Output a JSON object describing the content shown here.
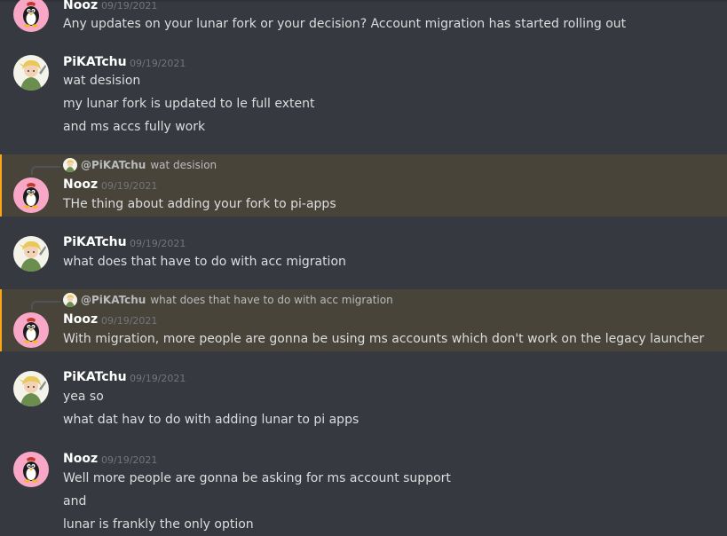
{
  "users": {
    "nooz": {
      "name": "Nooz",
      "avatar_icon": "tux-penguin-avatar",
      "avatar_color": "#f9a7c6"
    },
    "pika": {
      "name": "PiKATchu",
      "avatar_icon": "anime-character-avatar",
      "avatar_color": "#f3f3ea"
    }
  },
  "messages": [
    {
      "author": "Nooz",
      "timestamp": "09/19/2021",
      "lines": [
        "Any updates on your lunar fork or your decision? Account migration has started rolling out"
      ]
    },
    {
      "author": "PiKATchu",
      "timestamp": "09/19/2021",
      "lines": [
        "wat desision",
        "my lunar fork is updated to le full extent",
        "and ms accs fully work"
      ]
    },
    {
      "author": "Nooz",
      "timestamp": "09/19/2021",
      "highlighted": true,
      "reply_to": {
        "name": "@PiKATchu",
        "text": "wat desision"
      },
      "lines": [
        "THe thing about adding your fork to pi-apps"
      ]
    },
    {
      "author": "PiKATchu",
      "timestamp": "09/19/2021",
      "lines": [
        "what does that have to do with acc migration"
      ]
    },
    {
      "author": "Nooz",
      "timestamp": "09/19/2021",
      "highlighted": true,
      "reply_to": {
        "name": "@PiKATchu",
        "text": "what does that have to do with acc migration"
      },
      "lines": [
        "With migration, more people are gonna be using ms accounts which don't work on the legacy launcher"
      ]
    },
    {
      "author": "PiKATchu",
      "timestamp": "09/19/2021",
      "lines": [
        "yea so",
        "what dat hav to do with adding lunar to pi apps"
      ]
    },
    {
      "author": "Nooz",
      "timestamp": "09/19/2021",
      "lines": [
        "Well more people are gonna be asking for ms account support",
        "and",
        "lunar is frankly the only option"
      ]
    }
  ],
  "colors": {
    "background": "#36393f",
    "mention_highlight": "#48443a",
    "mention_bar": "#faa61a"
  }
}
